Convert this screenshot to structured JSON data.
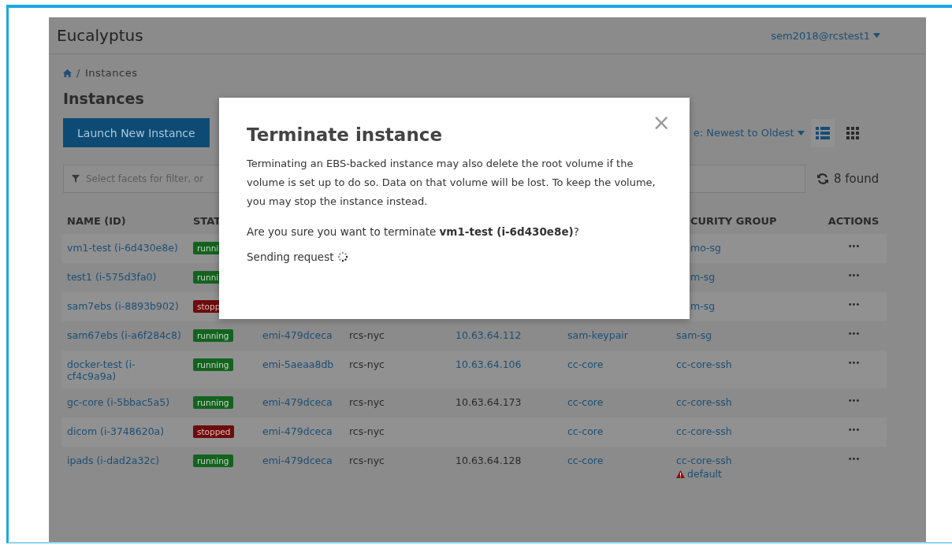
{
  "header": {
    "brand": "Eucalyptus",
    "user_menu": "sem2018@rcstest1"
  },
  "breadcrumb": {
    "separator": "/",
    "current": "Instances"
  },
  "page_title": "Instances",
  "launch_button": "Launch New Instance",
  "sort_menu": "e: Newest to Oldest",
  "view_toggles": [
    {
      "kind": "list",
      "selected": true
    },
    {
      "kind": "grid",
      "selected": false
    }
  ],
  "filter": {
    "placeholder": "Select facets for filter, or"
  },
  "found_count": "8 found",
  "table": {
    "header": {
      "name": "NAME (ID)",
      "status": "STAT",
      "security_group": "CURITY GROUP",
      "actions": "ACTIONS"
    },
    "rows": [
      {
        "name": "vm1-test (i-6d430e8e)",
        "status": {
          "text": "runni",
          "kind": "running"
        },
        "security_group": "mo-sg",
        "actions": "•••"
      },
      {
        "name": "test1 (i-575d3fa0)",
        "status": {
          "text": "runni",
          "kind": "running"
        },
        "security_group": "m-sg",
        "actions": "•••"
      },
      {
        "name": "sam7ebs (i-8893b902)",
        "status": {
          "text": "stopp",
          "kind": "stopped"
        },
        "security_group": "m-sg",
        "actions": "•••"
      },
      {
        "name": "sam67ebs (i-a6f284c8)",
        "status": {
          "text": "running",
          "kind": "running"
        },
        "image": "emi-479dceca",
        "zone": "rcs-nyc",
        "ip": "10.63.64.112",
        "ip_link": true,
        "keypair": "sam-keypair",
        "security_group": "sam-sg",
        "actions": "•••"
      },
      {
        "name": "docker-test (i-cf4c9a9a)",
        "status": {
          "text": "running",
          "kind": "running"
        },
        "image": "emi-5aeaa8db",
        "zone": "rcs-nyc",
        "ip": "10.63.64.106",
        "ip_link": true,
        "keypair": "cc-core",
        "security_group": "cc-core-ssh",
        "actions": "•••"
      },
      {
        "name": "gc-core (i-5bbac5a5)",
        "status": {
          "text": "running",
          "kind": "running"
        },
        "image": "emi-479dceca",
        "zone": "rcs-nyc",
        "ip": "10.63.64.173",
        "ip_link": false,
        "keypair": "cc-core",
        "security_group": "cc-core-ssh",
        "actions": "•••"
      },
      {
        "name": "dicom (i-3748620a)",
        "status": {
          "text": "stopped",
          "kind": "stopped"
        },
        "image": "emi-479dceca",
        "zone": "rcs-nyc",
        "keypair": "cc-core",
        "security_group": "cc-core-ssh",
        "actions": "•••"
      },
      {
        "name": "ipads (i-dad2a32c)",
        "status": {
          "text": "running",
          "kind": "running"
        },
        "image": "emi-479dceca",
        "zone": "rcs-nyc",
        "ip": "10.63.64.128",
        "ip_link": false,
        "keypair": "cc-core",
        "security_group": "cc-core-ssh",
        "security_warning": "default",
        "actions": "•••"
      }
    ]
  },
  "modal": {
    "title": "Terminate instance",
    "close": "×",
    "message": "Terminating an EBS-backed instance may also delete the root volume if the volume is set up to do so. Data on that volume will be lost. To keep the volume, you may stop the instance instead.",
    "question": "Are you sure you want to terminate **vm1-test (i-6d430e8e)**?",
    "status": "Sending request"
  }
}
